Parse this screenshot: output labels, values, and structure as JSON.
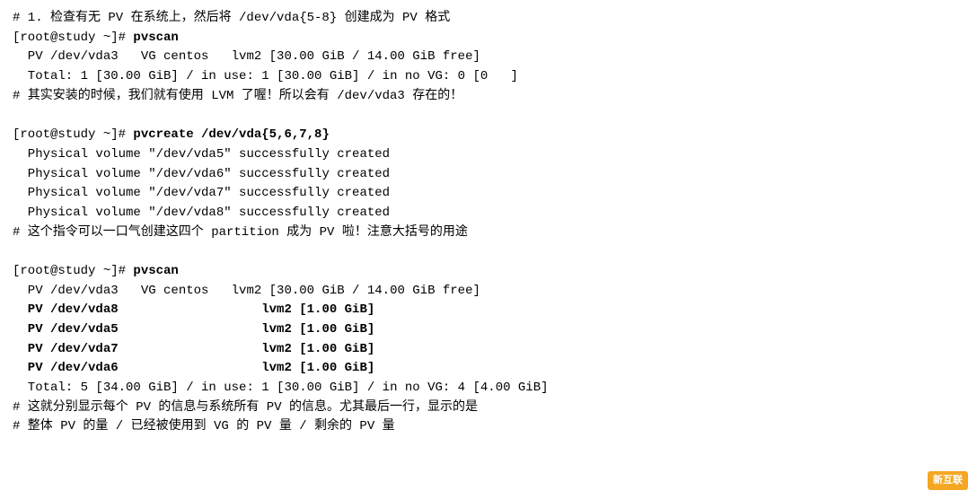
{
  "terminal": {
    "lines": [
      {
        "type": "comment",
        "text": "# 1. 检查有无 PV 在系统上，然后将 /dev/vda{5-8} 创建成为 PV 格式"
      },
      {
        "type": "prompt",
        "text": "[root@study ~]# ",
        "cmd": "pvscan"
      },
      {
        "type": "output",
        "text": "  PV /dev/vda3   VG centos   lvm2 [30.00 GiB / 14.00 GiB free]"
      },
      {
        "type": "output",
        "text": "  Total: 1 [30.00 GiB] / in use: 1 [30.00 GiB] / in no VG: 0 [0   ]"
      },
      {
        "type": "comment",
        "text": "# 其实安装的时候，我们就有使用 LVM 了喔！所以会有 /dev/vda3 存在的！"
      },
      {
        "type": "blank"
      },
      {
        "type": "prompt",
        "text": "[root@study ~]# ",
        "cmd": "pvcreate /dev/vda{5,6,7,8}"
      },
      {
        "type": "output",
        "text": "  Physical volume \"/dev/vda5\" successfully created"
      },
      {
        "type": "output",
        "text": "  Physical volume \"/dev/vda6\" successfully created"
      },
      {
        "type": "output",
        "text": "  Physical volume \"/dev/vda7\" successfully created"
      },
      {
        "type": "output",
        "text": "  Physical volume \"/dev/vda8\" successfully created"
      },
      {
        "type": "comment",
        "text": "# 这个指令可以一口气创建这四个 partition 成为 PV 啦！注意大括号的用途"
      },
      {
        "type": "blank"
      },
      {
        "type": "prompt",
        "text": "[root@study ~]# ",
        "cmd": "pvscan"
      },
      {
        "type": "output",
        "text": "  PV /dev/vda3   VG centos   lvm2 [30.00 GiB / 14.00 GiB free]"
      },
      {
        "type": "output_bold",
        "text": "  PV /dev/vda8                   lvm2 [1.00 GiB]"
      },
      {
        "type": "output_bold",
        "text": "  PV /dev/vda5                   lvm2 [1.00 GiB]"
      },
      {
        "type": "output_bold",
        "text": "  PV /dev/vda7                   lvm2 [1.00 GiB]"
      },
      {
        "type": "output_bold",
        "text": "  PV /dev/vda6                   lvm2 [1.00 GiB]"
      },
      {
        "type": "output",
        "text": "  Total: 5 [34.00 GiB] / in use: 1 [30.00 GiB] / in no VG: 4 [4.00 GiB]"
      },
      {
        "type": "comment",
        "text": "# 这就分别显示每个 PV 的信息与系统所有 PV 的信息。尤其最后一行，显示的是"
      },
      {
        "type": "comment",
        "text": "# 整体 PV 的量 / 已经被使用到 VG 的 PV 量 / 剩余的 PV 量"
      }
    ]
  },
  "watermark": {
    "label": "新互联"
  }
}
